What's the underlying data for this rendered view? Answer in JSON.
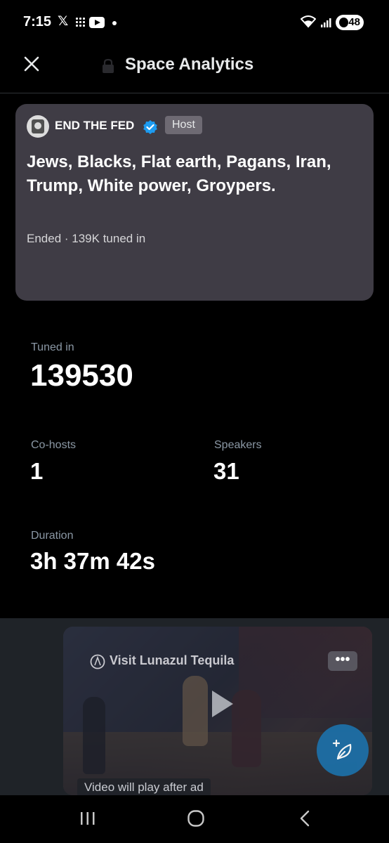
{
  "status_bar": {
    "time": "7:15",
    "x_glyph": "𝕏",
    "battery": "48",
    "icons": [
      "x-app-icon",
      "grid-app-icon",
      "youtube-icon",
      "notification-dot",
      "wifi-icon",
      "signal-icon",
      "battery-icon"
    ]
  },
  "header": {
    "title": "Space Analytics",
    "close_icon": "close-icon",
    "lock_icon": "lock-icon"
  },
  "space_card": {
    "host_name": "END THE FED",
    "host_badge": "Host",
    "title": "Jews, Blacks, Flat earth, Pagans, Iran, Trump, White power, Groypers.",
    "meta": "Ended · 139K tuned in"
  },
  "stats": {
    "tuned_in_label": "Tuned in",
    "tuned_in_value": "139530",
    "cohosts_label": "Co-hosts",
    "cohosts_value": "1",
    "speakers_label": "Speakers",
    "speakers_value": "31",
    "duration_label": "Duration",
    "duration_value": "3h 37m 42s"
  },
  "ad": {
    "brand": "Visit Lunazul Tequila",
    "more": "•••",
    "caption": "Video will play after ad"
  },
  "colors": {
    "background": "#000000",
    "card": "#3f3c45",
    "verified": "#1d9bf0",
    "fab": "#1d6fa6",
    "muted_text": "#8b98a5"
  }
}
